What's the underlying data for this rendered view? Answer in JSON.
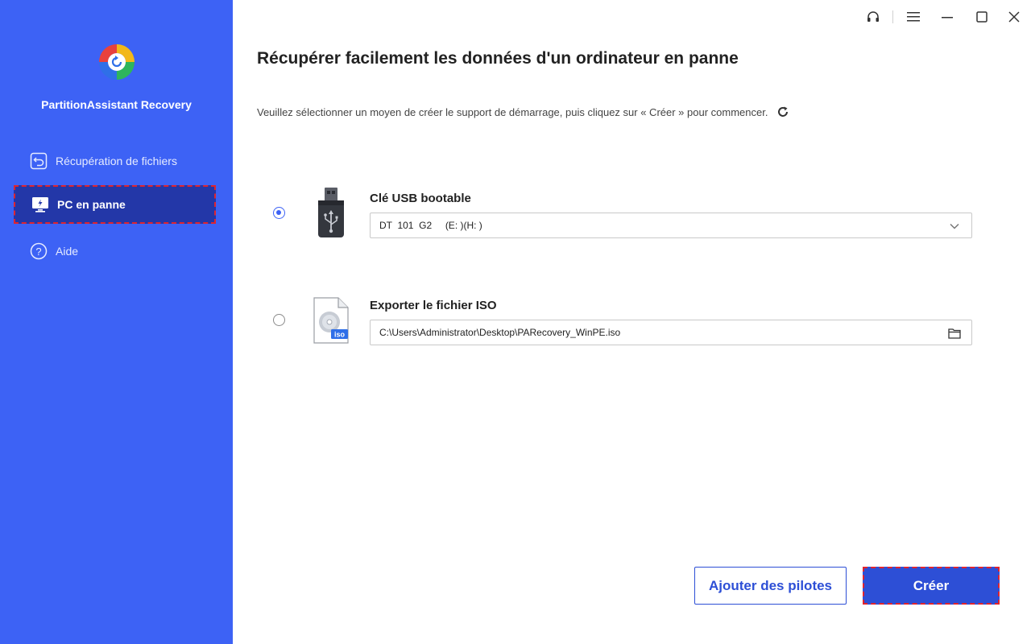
{
  "sidebar": {
    "app_name": "PartitionAssistant Recovery",
    "items": [
      {
        "label": "Récupération de fichiers",
        "icon": "file-restore-icon"
      },
      {
        "label": "PC en panne",
        "icon": "crashed-pc-icon",
        "active": true
      },
      {
        "label": "Aide",
        "icon": "help-icon"
      }
    ]
  },
  "window_controls": [
    "headset-icon",
    "menu-icon",
    "minimize-icon",
    "maximize-icon",
    "close-icon"
  ],
  "main": {
    "title": "Récupérer facilement les données d'un ordinateur en panne",
    "subtitle": "Veuillez sélectionner un moyen de créer le support de démarrage, puis cliquez sur « Créer » pour commencer.",
    "options": {
      "usb": {
        "label": "Clé USB bootable",
        "selected_drive": "DT  101  G2     (E: )(H: )",
        "checked": true
      },
      "iso": {
        "label": "Exporter le fichier ISO",
        "path": "C:\\Users\\Administrator\\Desktop\\PARecovery_WinPE.iso",
        "checked": false
      }
    }
  },
  "buttons": {
    "add_drivers": "Ajouter des pilotes",
    "create": "Créer"
  },
  "colors": {
    "sidebar": "#3d62f5",
    "sidebar_active": "#2337a8",
    "primary": "#2d4fd6",
    "highlight_dash": "#e0232e"
  }
}
